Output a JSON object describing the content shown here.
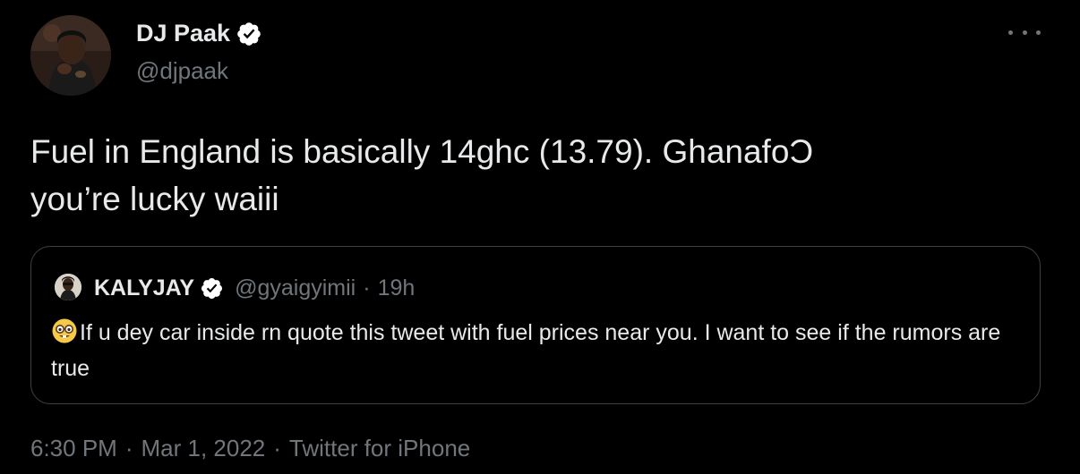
{
  "author": {
    "name": "DJ Paak",
    "handle": "@djpaak",
    "avatar_icon": "profile-photo",
    "verified_icon": "verified-badge-icon"
  },
  "tweet": {
    "text": "Fuel in England is basically 14ghc (13.79). GhanafoƆ\nyou’re lucky waiii"
  },
  "quoted_tweet": {
    "name": "KALYJAY",
    "handle": "@gyaigyimii",
    "separator": "·",
    "time": "19h",
    "emoji_icon": "nerd-face-emoji",
    "text": "If u dey car inside rn quote this tweet with fuel prices near you. I want to see if the rumors are true"
  },
  "meta": {
    "time": "6:30 PM",
    "separator1": "·",
    "date": "Mar 1, 2022",
    "separator2": "·",
    "source": "Twitter for iPhone"
  },
  "colors": {
    "background": "#000000",
    "text": "#e7e9ea",
    "muted": "#71767b",
    "border": "#3d4044",
    "verified": "#ffffff"
  }
}
